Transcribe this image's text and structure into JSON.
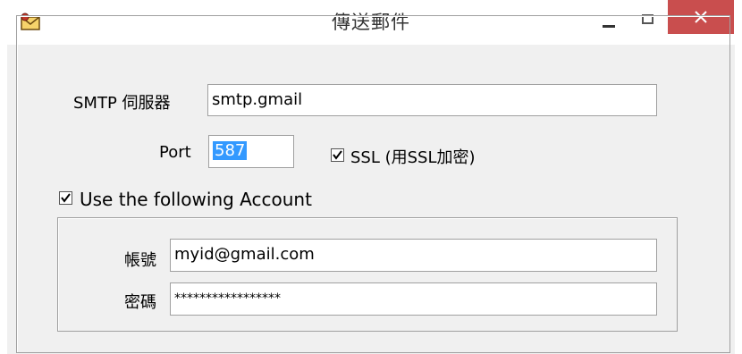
{
  "window": {
    "title": "傳送郵件"
  },
  "smtp": {
    "server_label": "SMTP 伺服器",
    "server_value": "smtp.gmail",
    "port_label": "Port",
    "port_value": "587",
    "ssl_label": "SSL (用SSL加密)",
    "ssl_checked": true
  },
  "account": {
    "use_account_label": "Use the following Account",
    "use_account_checked": true,
    "username_label": "帳號",
    "username_value": "myid@gmail.com",
    "password_label": "密碼",
    "password_value": "*****************"
  }
}
